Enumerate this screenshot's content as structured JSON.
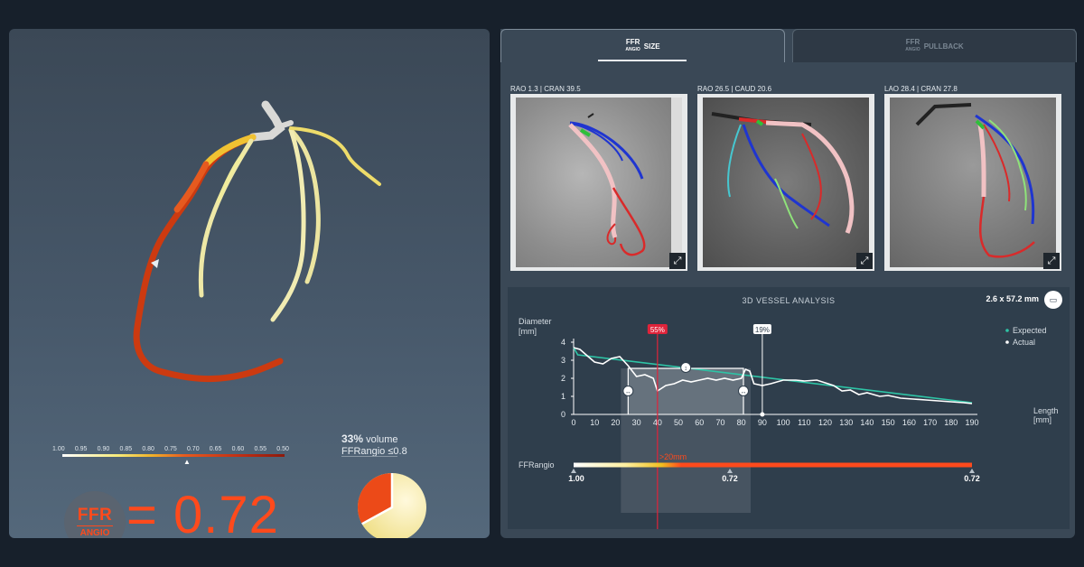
{
  "scale": {
    "labels": [
      "1.00",
      "0.95",
      "0.90",
      "0.85",
      "0.80",
      "0.75",
      "0.70",
      "0.65",
      "0.60",
      "0.55",
      "0.50"
    ]
  },
  "result": {
    "brand_top": "FFR",
    "brand_bottom": "ANGIO",
    "value": "= 0.72"
  },
  "volume": {
    "percent": "33%",
    "percent_suffix": " volume",
    "criterion": "FFRangio ≤0.8",
    "fraction": 0.33
  },
  "tabs": [
    {
      "brand_top": "FFR",
      "brand_bottom": "ANGIO",
      "label": "SIZE",
      "active": true
    },
    {
      "brand_top": "FFR",
      "brand_bottom": "ANGIO",
      "label": "PULLBACK",
      "active": false
    }
  ],
  "views": [
    {
      "label": "RAO 1.3 | CRAN 39.5"
    },
    {
      "label": "RAO 26.5 | CAUD 20.6"
    },
    {
      "label": "LAO 28.4 | CRAN 27.8"
    }
  ],
  "analysis": {
    "title": "3D VESSEL ANALYSIS",
    "size": "2.6 x 57.2 mm",
    "ylabel": "Diameter",
    "yunit": "[mm]",
    "xlabel": "Length",
    "xunit": "[mm]",
    "legend": [
      "Expected",
      "Actual"
    ],
    "marker_red": "55%",
    "marker_white": "19%",
    "segment_label": ">20mm",
    "ffr_label": "FFRangio",
    "ffr_ticks": [
      "1.00",
      "0.72",
      "0.72"
    ]
  },
  "chart_data": {
    "type": "line",
    "xlabel": "Length [mm]",
    "ylabel": "Diameter [mm]",
    "xlim": [
      0,
      190
    ],
    "ylim": [
      0,
      4
    ],
    "xticks": [
      0,
      10,
      20,
      30,
      40,
      50,
      60,
      70,
      80,
      90,
      100,
      110,
      120,
      130,
      140,
      150,
      160,
      170,
      180,
      190
    ],
    "yticks": [
      0,
      1,
      2,
      3,
      4
    ],
    "series": [
      {
        "name": "Expected",
        "color": "#2ec4a6",
        "points": [
          [
            0,
            3.7
          ],
          [
            2,
            3.3
          ],
          [
            190,
            0.65
          ]
        ]
      },
      {
        "name": "Actual",
        "color": "#ffffff",
        "points": [
          [
            0,
            3.7
          ],
          [
            3,
            3.6
          ],
          [
            6,
            3.3
          ],
          [
            10,
            2.9
          ],
          [
            14,
            2.8
          ],
          [
            18,
            3.1
          ],
          [
            22,
            3.2
          ],
          [
            26,
            2.7
          ],
          [
            30,
            2.1
          ],
          [
            34,
            2.2
          ],
          [
            38,
            2.0
          ],
          [
            40,
            1.3
          ],
          [
            44,
            1.6
          ],
          [
            48,
            1.7
          ],
          [
            52,
            1.9
          ],
          [
            56,
            1.8
          ],
          [
            60,
            1.9
          ],
          [
            64,
            2.0
          ],
          [
            68,
            1.9
          ],
          [
            72,
            2.0
          ],
          [
            76,
            1.9
          ],
          [
            80,
            2.0
          ],
          [
            82,
            2.5
          ],
          [
            84,
            2.4
          ],
          [
            86,
            1.7
          ],
          [
            90,
            1.6
          ],
          [
            94,
            1.7
          ],
          [
            100,
            1.9
          ],
          [
            106,
            1.9
          ],
          [
            110,
            1.85
          ],
          [
            116,
            1.9
          ],
          [
            120,
            1.75
          ],
          [
            124,
            1.6
          ],
          [
            128,
            1.3
          ],
          [
            132,
            1.35
          ],
          [
            136,
            1.1
          ],
          [
            140,
            1.2
          ],
          [
            146,
            1.0
          ],
          [
            150,
            1.05
          ],
          [
            156,
            0.9
          ],
          [
            162,
            0.85
          ],
          [
            168,
            0.8
          ],
          [
            174,
            0.75
          ],
          [
            180,
            0.7
          ],
          [
            186,
            0.65
          ],
          [
            190,
            0.6
          ]
        ]
      }
    ],
    "stenosis_region": [
      26,
      81
    ],
    "markers": [
      {
        "label": "55%",
        "x": 40
      },
      {
        "label": "19%",
        "x": 90
      }
    ]
  },
  "colors": {
    "accent": "#ff4a1c",
    "expected": "#2ec4a6",
    "marker_red": "#e0233a"
  }
}
